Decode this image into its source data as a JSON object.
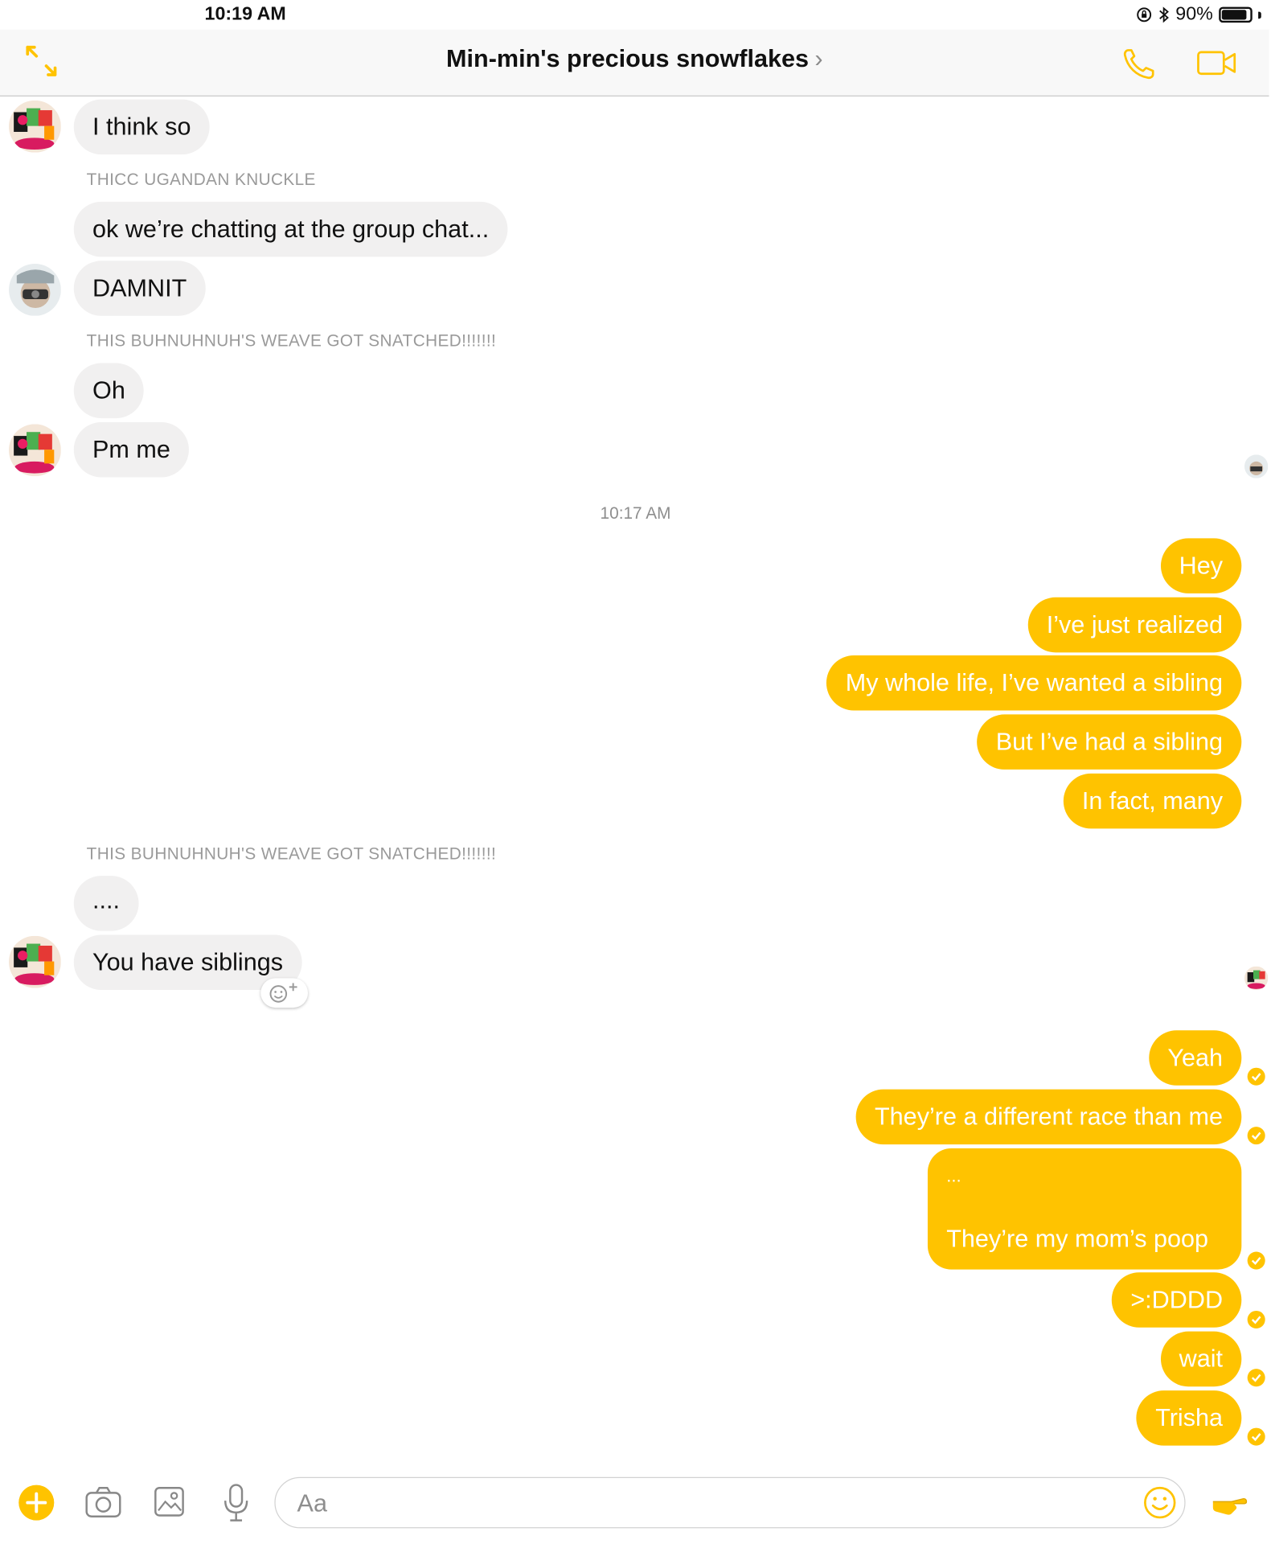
{
  "status_bar": {
    "time": "10:19 AM",
    "battery": "90%",
    "battery_level": 0.9
  },
  "header": {
    "title": "Min-min's precious snowflakes",
    "chevron": "›"
  },
  "messages": {
    "m1": "I think so",
    "sender1": "THICC UGANDAN KNUCKLE",
    "m2": "ok we’re chatting at the group chat...",
    "m3": "DAMNIT",
    "sender2": "THIS BUHNUHNUH'S WEAVE GOT SNATCHED!!!!!!!",
    "m4": "Oh",
    "m5": "Pm me",
    "timestamp": "10:17 AM",
    "o1": "Hey",
    "o2": "I’ve just realized",
    "o3": "My whole life, I’ve wanted a sibling",
    "o4": "But I’ve had a sibling",
    "o5": "In fact, many",
    "sender3": "THIS BUHNUHNUH'S WEAVE GOT SNATCHED!!!!!!!",
    "m6": "....",
    "m7": "You have siblings",
    "o6": "Yeah",
    "o7": "They’re a different race than me",
    "o8_line1": "...",
    "o8_line2": "They’re my mom’s poop",
    "o9": ">:DDDD",
    "o10": "wait",
    "o11": "Trisha"
  },
  "composer": {
    "placeholder": "Aa"
  },
  "colors": {
    "accent": "#ffc300",
    "incoming_bubble": "#f1f0f0"
  },
  "icons": [
    "expand-icon",
    "phone-icon",
    "video-icon",
    "plus-icon",
    "camera-icon",
    "gallery-icon",
    "microphone-icon",
    "emoji-icon",
    "thumbs-hand-icon",
    "react-icon",
    "check-icon"
  ]
}
